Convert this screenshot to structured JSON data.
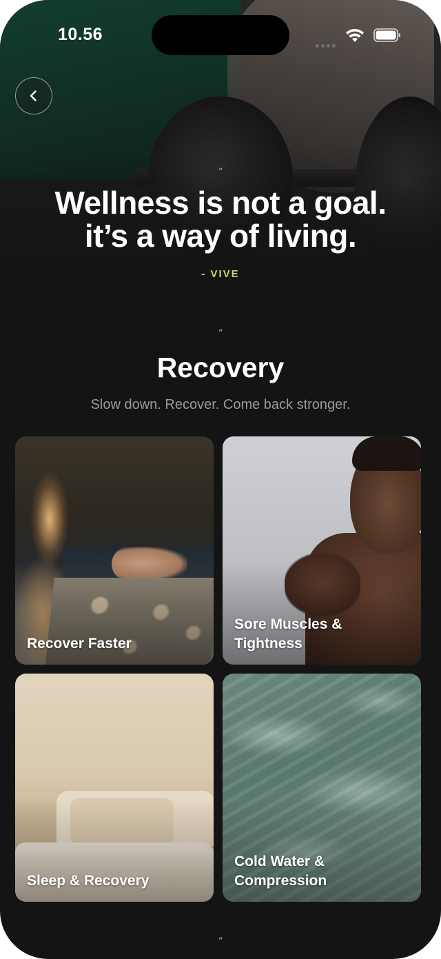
{
  "status_bar": {
    "time": "10.56"
  },
  "hero": {
    "quote_mark": "“",
    "quote_line_1": "Wellness is not a goal.",
    "quote_line_2": "it’s a way of living.",
    "author": "- VIVE"
  },
  "section": {
    "quote_mark": "“",
    "title": "Recovery",
    "subtitle": "Slow down. Recover. Come back stronger."
  },
  "cards": [
    {
      "label": "Recover Faster"
    },
    {
      "label": "Sore Muscles & Tightness"
    },
    {
      "label": "Sleep & Recovery"
    },
    {
      "label": "Cold Water & Compression"
    }
  ],
  "footer": {
    "quote_mark": "“"
  },
  "icons": {
    "back": "chevron-left-icon",
    "wifi": "wifi-icon",
    "battery": "battery-icon"
  },
  "colors": {
    "background": "#141414",
    "accent": "#c4d86f",
    "subtitle": "#9a9a9a"
  }
}
